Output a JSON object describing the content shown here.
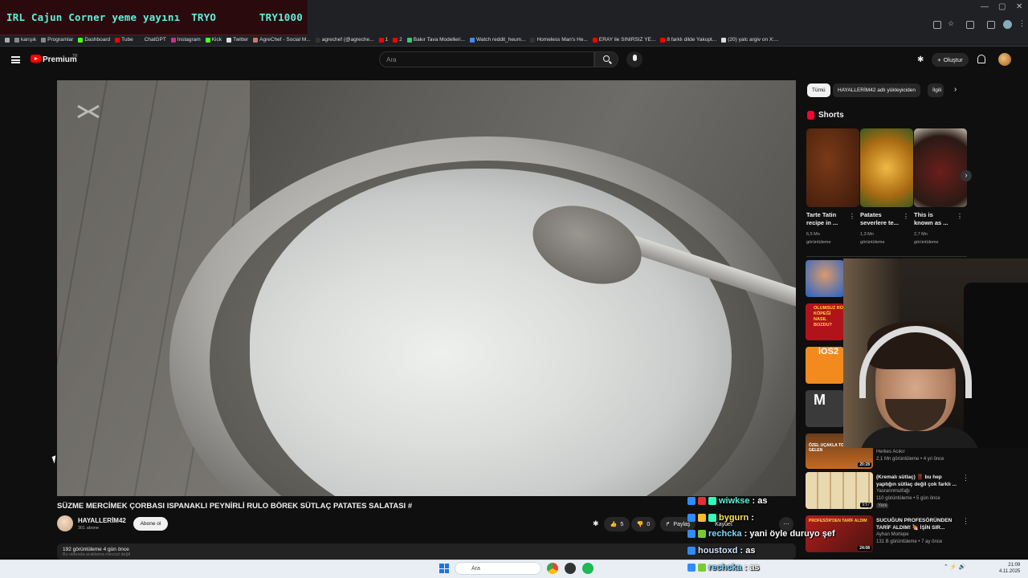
{
  "stream_overlay": {
    "title": "IRL Cajun Corner yeme yayını",
    "code1": "TRYO",
    "code2": "TRY1000"
  },
  "bookmarks": [
    "karışık",
    "Programlar",
    "Dashboard",
    "Tube",
    "ChatGPT",
    "Instagram",
    "Kick",
    "Twitter",
    "AgreChef - Social M...",
    "agrechef (@agreche...",
    "1",
    "2",
    "Bakır Tava Modelleri...",
    "Watch reddit_heum...",
    "Homeless Man's He...",
    "ERAY ile SINIRSIZ YE...",
    "8 farklı dilde Yakupt...",
    "(20) yalc argiv on X:..."
  ],
  "youtube": {
    "brand": "Premium",
    "brand_sup": "TR",
    "search_placeholder": "Ara",
    "create_label": "Oluştur"
  },
  "video": {
    "title": "SÜZME MERCİMEK ÇORBASI ISPANAKLI PEYNİRLİ RULO BÖREK SÜTLAÇ PATATES SALATASI #",
    "channel": "HAYALLERİM42",
    "subscribers": "301 abone",
    "subscribe_label": "Abone ol",
    "likes": "5",
    "dislikes": "0",
    "share_label": "Paylaş",
    "save_label": "Kaydet",
    "views_date": "192 görüntüleme  4 gün önce",
    "desc_sub": "Bu videoda araklama mevcut değil"
  },
  "chips": [
    "Tümü",
    "HAYALLERİM42 adlı yükleyiciden",
    "İlgili"
  ],
  "shorts": {
    "title": "Shorts",
    "items": [
      {
        "title1": "Tarte Tatin",
        "title2": "recipe in ...",
        "views": "6,5 Mn",
        "views_label": "görüntüleme"
      },
      {
        "title1": "Patates",
        "title2": "severlere te...",
        "views": "1,3 Mn",
        "views_label": "görüntüleme"
      },
      {
        "title1": "This is",
        "title2": "known as ...",
        "views": "2,7 Mn",
        "views_label": "görüntüleme"
      }
    ]
  },
  "recommendations": [
    {
      "thumb_text": "",
      "title": "",
      "channel": "Herkes Acıkır",
      "meta": "2,1 Mn görüntüleme • 4 yıl önce",
      "duration": ""
    },
    {
      "thumb_text": "ÖZEL UÇAKLA TOST YEMEYE GELEN",
      "title": "",
      "channel": "",
      "meta": "",
      "duration": "20:28"
    },
    {
      "thumb_text": "",
      "title": "(Kremalı sütlaç) ‼️ bu hep yaptığın sütlaç değil çok farklı ...",
      "channel": "Yasrannmutfağı",
      "meta": "110 görüntüleme • 5 gün önce",
      "badge": "Yeni",
      "duration": "9:57"
    },
    {
      "thumb_text": "PROFESÖR'DEN TARİF ALDIM",
      "title": "SUCUĞUN PROFESÖRÜNDEN TARİF ALDIM! 🍖 İŞİN SIR...",
      "channel": "Ayhan Mortepe",
      "meta": "131 B görüntüleme • 7 ay önce",
      "duration": "24:08"
    }
  ],
  "thumb_labels": {
    "t2a": "OLUMSUZ RO",
    "t2b": "KÖPEĞİ",
    "t2c": "NASIL",
    "t2d": "BOZDU?",
    "t3": "iOS2",
    "t4": "M"
  },
  "chat": [
    {
      "user": "wiwkse",
      "msg": ": as"
    },
    {
      "user": "bygurn",
      "msg": ":"
    },
    {
      "user": "rechcka",
      "msg": ": yani öyle duruyo şef"
    },
    {
      "user": "houstoxd",
      "msg": ": as"
    },
    {
      "user": "rechcka",
      "msg": ": as"
    }
  ],
  "taskbar": {
    "search_placeholder": "Ara",
    "time": "21:09",
    "date": "4.11.2025"
  },
  "colors": {
    "accent": "#ff0000",
    "overlay_text": "#5ef0d8",
    "background": "#0f0f0f"
  }
}
